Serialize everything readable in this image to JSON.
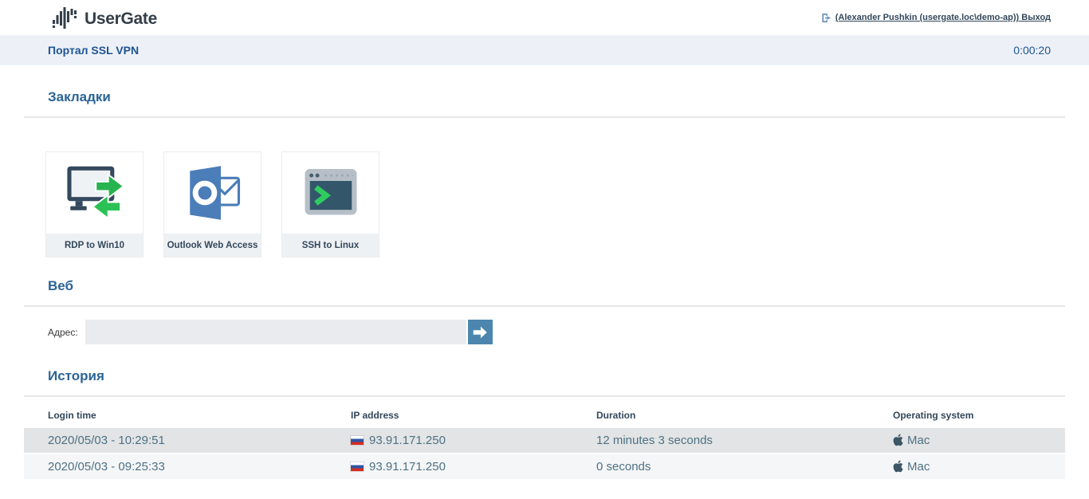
{
  "header": {
    "logo_text": "UserGate",
    "user_link": "(Alexander Pushkin (usergate.loc\\demo-ap)) Выход"
  },
  "subheader": {
    "title": "Портал SSL VPN",
    "timer": "0:00:20"
  },
  "bookmarks": {
    "heading": "Закладки",
    "tiles": [
      {
        "label": "RDP to Win10",
        "icon": "rdp-monitor-icon"
      },
      {
        "label": "Outlook Web Access",
        "icon": "outlook-icon"
      },
      {
        "label": "SSH to Linux",
        "icon": "terminal-icon"
      }
    ]
  },
  "web": {
    "heading": "Веб",
    "address_label": "Адрес:",
    "address_value": "",
    "go_icon": "arrow-right-icon"
  },
  "history": {
    "heading": "История",
    "columns": [
      "Login time",
      "IP address",
      "Duration",
      "Operating system"
    ],
    "rows": [
      {
        "login_time": "2020/05/03 - 10:29:51",
        "flag_icon": "russia-flag-icon",
        "ip": "93.91.171.250",
        "duration": "12 minutes 3 seconds",
        "os_icon": "apple-icon",
        "os": "Mac"
      },
      {
        "login_time": "2020/05/03 - 09:25:33",
        "flag_icon": "russia-flag-icon",
        "ip": "93.91.171.250",
        "duration": "0 seconds",
        "os_icon": "apple-icon",
        "os": "Mac"
      }
    ]
  },
  "colors": {
    "heading_blue": "#2a6496",
    "subbar_bg": "#edf1f7",
    "subbar_text": "#1d5494",
    "logo_navy": "#333e48",
    "row_odd_bg": "#e2e4e5",
    "row_even_bg": "#f5f6f7",
    "row_text": "#4e7183",
    "go_button_bg": "#4c86ae",
    "tile_label_bg": "#eef1f4",
    "arrow_green": "#27b34f",
    "outlook_blue": "#4b7db8",
    "terminal_screen": "#33566a"
  }
}
